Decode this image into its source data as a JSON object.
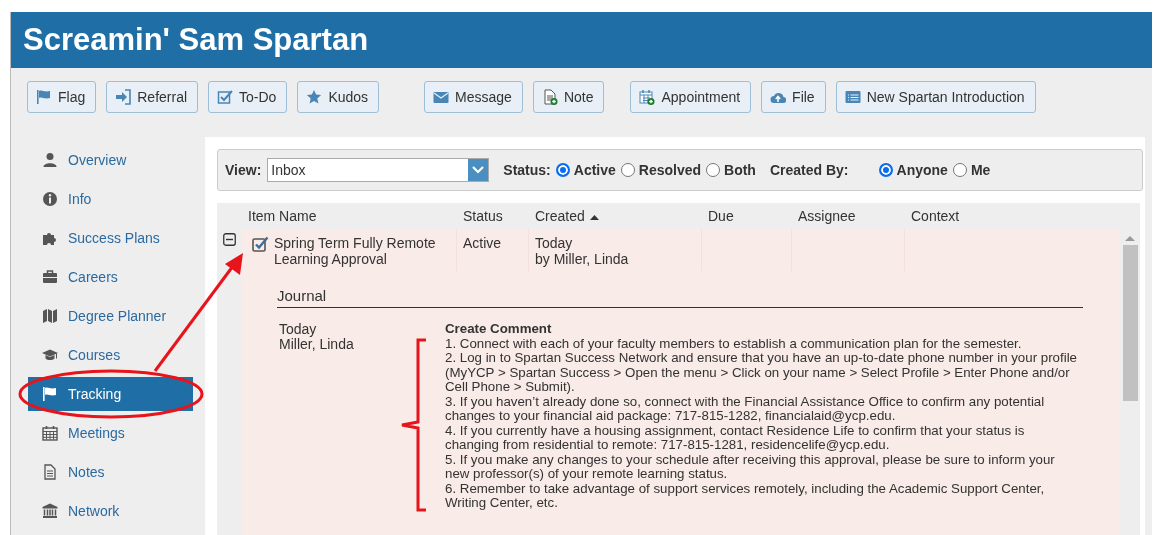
{
  "header": {
    "title": "Screamin' Sam Spartan"
  },
  "toolbar_groups": [
    {
      "buttons": [
        {
          "label": "Flag",
          "kind": "flag"
        },
        {
          "label": "Referral",
          "kind": "signin"
        },
        {
          "label": "To-Do",
          "kind": "check"
        },
        {
          "label": "Kudos",
          "kind": "star"
        }
      ]
    },
    {
      "buttons": [
        {
          "label": "Message",
          "kind": "envelope"
        },
        {
          "label": "Note",
          "kind": "docplus"
        }
      ]
    },
    {
      "buttons": [
        {
          "label": "Appointment",
          "kind": "calplus"
        },
        {
          "label": "File",
          "kind": "cloud"
        },
        {
          "label": "New Spartan Introduction",
          "kind": "list"
        }
      ]
    }
  ],
  "sidebar": {
    "items": [
      {
        "label": "Overview",
        "kind": "person",
        "selected": false
      },
      {
        "label": "Info",
        "kind": "info",
        "selected": false
      },
      {
        "label": "Success Plans",
        "kind": "puzzle",
        "selected": false
      },
      {
        "label": "Careers",
        "kind": "briefcase",
        "selected": false
      },
      {
        "label": "Degree Planner",
        "kind": "map",
        "selected": false
      },
      {
        "label": "Courses",
        "kind": "cap",
        "selected": false
      },
      {
        "label": "Tracking",
        "kind": "flag",
        "selected": true
      },
      {
        "label": "Meetings",
        "kind": "calendar",
        "selected": false
      },
      {
        "label": "Notes",
        "kind": "doc",
        "selected": false
      },
      {
        "label": "Network",
        "kind": "bank",
        "selected": false
      }
    ]
  },
  "filters": {
    "view_label": "View:",
    "view_value": "Inbox",
    "status_label": "Status:",
    "status_options": [
      {
        "label": "Active",
        "selected": true
      },
      {
        "label": "Resolved",
        "selected": false
      },
      {
        "label": "Both",
        "selected": false
      }
    ],
    "created_by_label": "Created By:",
    "created_by_options": [
      {
        "label": "Anyone",
        "selected": true
      },
      {
        "label": "Me",
        "selected": false
      }
    ]
  },
  "table": {
    "columns": [
      {
        "label": "Item Name",
        "sorted": false
      },
      {
        "label": "Status",
        "sorted": false
      },
      {
        "label": "Created",
        "sorted": true
      },
      {
        "label": "Due",
        "sorted": false
      },
      {
        "label": "Assignee",
        "sorted": false
      },
      {
        "label": "Context",
        "sorted": false
      }
    ],
    "rows": [
      {
        "expanded": true,
        "checked": true,
        "item_name": "Spring Term Fully Remote Learning Approval",
        "status": "Active",
        "created": [
          "Today",
          "by Miller, Linda"
        ],
        "journal": {
          "title": "Journal",
          "entries": [
            {
              "date": "Today",
              "author": "Miller, Linda",
              "title": "Create Comment",
              "lines": [
                "1. Connect with each of your faculty members to establish a communication plan for the semester.",
                "2. Log in to Spartan Success Network and ensure that you have an up-to-date phone number in your profile (MyYCP > Spartan Success > Open the menu > Click on your name > Select Profile > Enter Phone and/or Cell Phone > Submit).",
                "3. If you haven’t already done so, connect with the Financial Assistance Office to confirm any potential changes to your financial aid package: 717-815-1282, financialaid@ycp.edu.",
                "4. If you currently have a housing assignment, contact Residence Life to confirm that your status is changing from residential to remote: 717-815-1281, residencelife@ycp.edu.",
                "5. If you make any changes to your schedule after receiving this approval, please be sure to inform your new professor(s) of your remote learning status.",
                "6. Remember to take advantage of support services remotely, including the Academic Support Center, Writing Center, etc."
              ]
            }
          ]
        }
      }
    ]
  }
}
